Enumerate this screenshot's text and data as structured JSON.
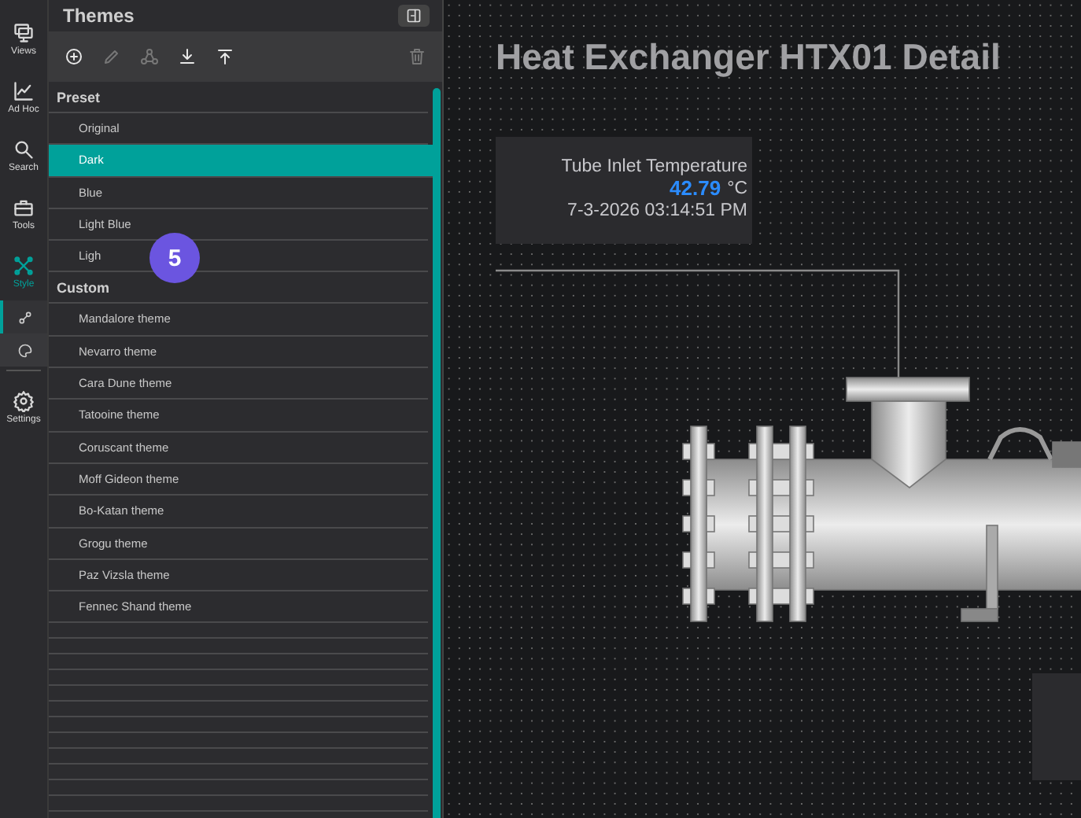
{
  "nav_rail": {
    "items": [
      {
        "label": "Views",
        "selected": false
      },
      {
        "label": "Ad Hoc",
        "selected": false
      },
      {
        "label": "Search",
        "selected": false
      },
      {
        "label": "Tools",
        "selected": false
      },
      {
        "label": "Style",
        "selected": true
      }
    ],
    "sub_items": [
      {
        "selected": true
      },
      {
        "selected": false
      }
    ],
    "settings": {
      "label": "Settings"
    }
  },
  "themes_panel": {
    "title": "Themes",
    "toolbar": [
      {
        "disabled": false
      },
      {
        "disabled": true
      },
      {
        "disabled": true
      },
      {
        "disabled": false
      },
      {
        "disabled": false
      },
      {
        "disabled": true
      }
    ],
    "groups": [
      {
        "title": "Preset",
        "items": [
          {
            "label": "Original",
            "selected": false
          },
          {
            "label": "Dark",
            "selected": true
          },
          {
            "label": "Blue",
            "selected": false
          },
          {
            "label": "Light Blue",
            "selected": false
          },
          {
            "label": "Ligh",
            "selected": false
          }
        ]
      },
      {
        "title": "Custom",
        "items": [
          {
            "label": "Mandalore theme",
            "selected": false
          },
          {
            "label": "Nevarro theme",
            "selected": false
          },
          {
            "label": "Cara Dune theme",
            "selected": false
          },
          {
            "label": "Tatooine theme",
            "selected": false
          },
          {
            "label": "Coruscant theme",
            "selected": false
          },
          {
            "label": "Moff Gideon theme",
            "selected": false
          },
          {
            "label": "Bo-Katan theme",
            "selected": false
          },
          {
            "label": "Grogu theme",
            "selected": false
          },
          {
            "label": "Paz Vizsla theme",
            "selected": false
          },
          {
            "label": "Fennec Shand theme",
            "selected": false
          }
        ]
      }
    ],
    "step_badge": {
      "text": "5"
    }
  },
  "canvas": {
    "title": "Heat Exchanger HTX01 Detail",
    "readout": {
      "label": "Tube Inlet Temperature",
      "value": "42.79",
      "unit": "°C",
      "timestamp": "7-3-2026 03:14:51 PM"
    }
  }
}
